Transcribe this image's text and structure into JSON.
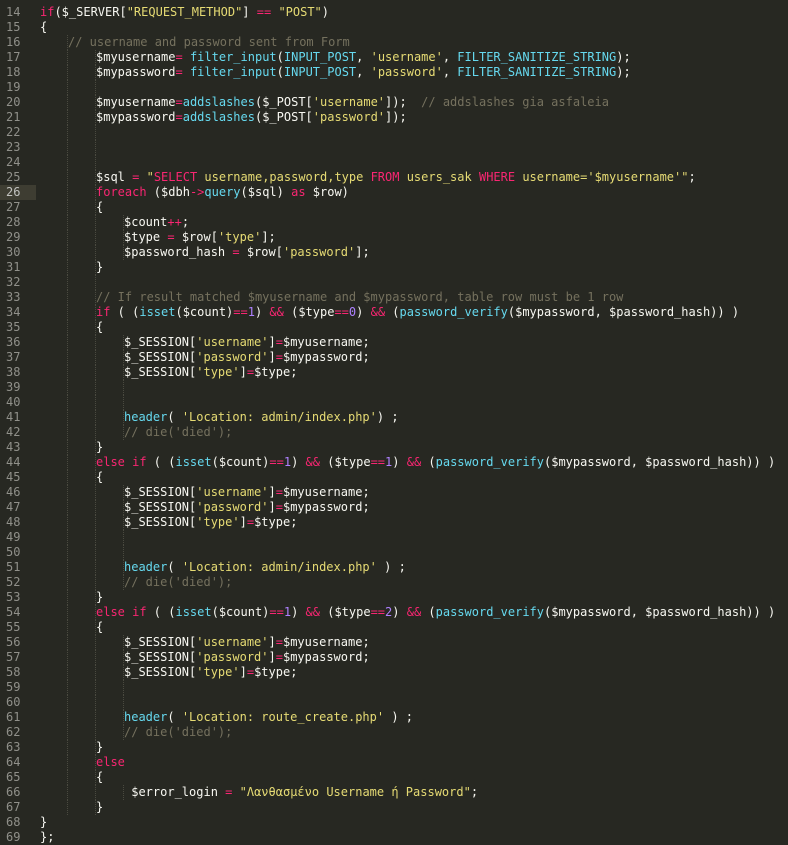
{
  "editor": {
    "colors": {
      "background": "#272822",
      "plain": "#f8f8f2",
      "keyword": "#f92672",
      "string": "#e6db74",
      "function": "#66d9ef",
      "number": "#ae81ff",
      "comment": "#75715e",
      "line_number": "#90908a"
    },
    "current_line": 26,
    "lines": [
      {
        "n": "14",
        "indent": 1,
        "tokens": [
          [
            "k",
            "if"
          ],
          [
            "p",
            "($_SERVER["
          ],
          [
            "s",
            "\"REQUEST_METHOD\""
          ],
          [
            "p",
            "] "
          ],
          [
            "k",
            "=="
          ],
          [
            "p",
            " "
          ],
          [
            "s",
            "\"POST\""
          ],
          [
            "p",
            ")"
          ]
        ]
      },
      {
        "n": "15",
        "indent": 1,
        "tokens": [
          [
            "p",
            "{"
          ]
        ]
      },
      {
        "n": "16",
        "indent": 2,
        "tokens": [
          [
            "c",
            "// username and password sent from Form"
          ]
        ]
      },
      {
        "n": "17",
        "indent": 3,
        "tokens": [
          [
            "p",
            "$myusername"
          ],
          [
            "k",
            "="
          ],
          [
            "p",
            " "
          ],
          [
            "f",
            "filter_input"
          ],
          [
            "p",
            "("
          ],
          [
            "f",
            "INPUT_POST"
          ],
          [
            "p",
            ", "
          ],
          [
            "s",
            "'username'"
          ],
          [
            "p",
            ", "
          ],
          [
            "f",
            "FILTER_SANITIZE_STRING"
          ],
          [
            "p",
            ");"
          ]
        ]
      },
      {
        "n": "18",
        "indent": 3,
        "tokens": [
          [
            "p",
            "$mypassword"
          ],
          [
            "k",
            "="
          ],
          [
            "p",
            " "
          ],
          [
            "f",
            "filter_input"
          ],
          [
            "p",
            "("
          ],
          [
            "f",
            "INPUT_POST"
          ],
          [
            "p",
            ", "
          ],
          [
            "s",
            "'password'"
          ],
          [
            "p",
            ", "
          ],
          [
            "f",
            "FILTER_SANITIZE_STRING"
          ],
          [
            "p",
            ");"
          ]
        ]
      },
      {
        "n": "19",
        "indent": 3,
        "tokens": []
      },
      {
        "n": "20",
        "indent": 3,
        "tokens": [
          [
            "p",
            "$myusername"
          ],
          [
            "k",
            "="
          ],
          [
            "f",
            "addslashes"
          ],
          [
            "p",
            "($_POST["
          ],
          [
            "s",
            "'username'"
          ],
          [
            "p",
            "]);  "
          ],
          [
            "c",
            "// addslashes gia asfaleia"
          ]
        ]
      },
      {
        "n": "21",
        "indent": 3,
        "tokens": [
          [
            "p",
            "$mypassword"
          ],
          [
            "k",
            "="
          ],
          [
            "f",
            "addslashes"
          ],
          [
            "p",
            "($_POST["
          ],
          [
            "s",
            "'password'"
          ],
          [
            "p",
            "]);"
          ]
        ]
      },
      {
        "n": "22",
        "indent": 3,
        "tokens": []
      },
      {
        "n": "23",
        "indent": 3,
        "tokens": []
      },
      {
        "n": "24",
        "indent": 3,
        "tokens": []
      },
      {
        "n": "25",
        "indent": 3,
        "tokens": [
          [
            "p",
            "$sql "
          ],
          [
            "k",
            "="
          ],
          [
            "p",
            " "
          ],
          [
            "s",
            "\""
          ],
          [
            "k",
            "SELECT"
          ],
          [
            "s",
            " username,password,type "
          ],
          [
            "k",
            "FROM"
          ],
          [
            "s",
            " users_sak "
          ],
          [
            "k",
            "WHERE"
          ],
          [
            "s",
            " username='$myusername'\""
          ],
          [
            "p",
            ";"
          ]
        ]
      },
      {
        "n": "26",
        "indent": 3,
        "tokens": [
          [
            "k",
            "foreach"
          ],
          [
            "p",
            " ($dbh"
          ],
          [
            "k",
            "->"
          ],
          [
            "f",
            "query"
          ],
          [
            "p",
            "($sql) "
          ],
          [
            "k",
            "as"
          ],
          [
            "p",
            " $row)"
          ]
        ]
      },
      {
        "n": "27",
        "indent": 3,
        "tokens": [
          [
            "p",
            "{"
          ]
        ]
      },
      {
        "n": "28",
        "indent": 4,
        "tokens": [
          [
            "p",
            "$count"
          ],
          [
            "k",
            "++"
          ],
          [
            "p",
            ";"
          ]
        ]
      },
      {
        "n": "29",
        "indent": 4,
        "tokens": [
          [
            "p",
            "$type "
          ],
          [
            "k",
            "="
          ],
          [
            "p",
            " $row["
          ],
          [
            "s",
            "'type'"
          ],
          [
            "p",
            "];"
          ]
        ]
      },
      {
        "n": "30",
        "indent": 4,
        "tokens": [
          [
            "p",
            "$password_hash "
          ],
          [
            "k",
            "="
          ],
          [
            "p",
            " $row["
          ],
          [
            "s",
            "'password'"
          ],
          [
            "p",
            "];"
          ]
        ]
      },
      {
        "n": "31",
        "indent": 3,
        "tokens": [
          [
            "p",
            "}"
          ]
        ]
      },
      {
        "n": "32",
        "indent": 3,
        "tokens": []
      },
      {
        "n": "33",
        "indent": 3,
        "tokens": [
          [
            "c",
            "// If result matched $myusername and $mypassword, table row must be 1 row"
          ]
        ]
      },
      {
        "n": "34",
        "indent": 3,
        "tokens": [
          [
            "k",
            "if"
          ],
          [
            "p",
            " ( ("
          ],
          [
            "f",
            "isset"
          ],
          [
            "p",
            "($count)"
          ],
          [
            "k",
            "=="
          ],
          [
            "n",
            "1"
          ],
          [
            "p",
            ") "
          ],
          [
            "k",
            "&&"
          ],
          [
            "p",
            " ($type"
          ],
          [
            "k",
            "=="
          ],
          [
            "n",
            "0"
          ],
          [
            "p",
            ") "
          ],
          [
            "k",
            "&&"
          ],
          [
            "p",
            " ("
          ],
          [
            "f",
            "password_verify"
          ],
          [
            "p",
            "($mypassword, $password_hash)) )"
          ]
        ]
      },
      {
        "n": "35",
        "indent": 3,
        "tokens": [
          [
            "p",
            "{"
          ]
        ]
      },
      {
        "n": "36",
        "indent": 4,
        "tokens": [
          [
            "p",
            "$_SESSION["
          ],
          [
            "s",
            "'username'"
          ],
          [
            "p",
            "]"
          ],
          [
            "k",
            "="
          ],
          [
            "p",
            "$myusername;"
          ]
        ]
      },
      {
        "n": "37",
        "indent": 4,
        "tokens": [
          [
            "p",
            "$_SESSION["
          ],
          [
            "s",
            "'password'"
          ],
          [
            "p",
            "]"
          ],
          [
            "k",
            "="
          ],
          [
            "p",
            "$mypassword;"
          ]
        ]
      },
      {
        "n": "38",
        "indent": 4,
        "tokens": [
          [
            "p",
            "$_SESSION["
          ],
          [
            "s",
            "'type'"
          ],
          [
            "p",
            "]"
          ],
          [
            "k",
            "="
          ],
          [
            "p",
            "$type;"
          ]
        ]
      },
      {
        "n": "39",
        "indent": 4,
        "tokens": []
      },
      {
        "n": "40",
        "indent": 4,
        "tokens": []
      },
      {
        "n": "41",
        "indent": 4,
        "tokens": [
          [
            "f",
            "header"
          ],
          [
            "p",
            "( "
          ],
          [
            "s",
            "'Location: admin/index.php'"
          ],
          [
            "p",
            ") ;"
          ]
        ]
      },
      {
        "n": "42",
        "indent": 4,
        "tokens": [
          [
            "c",
            "// die('died');"
          ]
        ]
      },
      {
        "n": "43",
        "indent": 3,
        "tokens": [
          [
            "p",
            "}"
          ]
        ]
      },
      {
        "n": "44",
        "indent": 3,
        "tokens": [
          [
            "k",
            "else if"
          ],
          [
            "p",
            " ( ("
          ],
          [
            "f",
            "isset"
          ],
          [
            "p",
            "($count)"
          ],
          [
            "k",
            "=="
          ],
          [
            "n",
            "1"
          ],
          [
            "p",
            ") "
          ],
          [
            "k",
            "&&"
          ],
          [
            "p",
            " ($type"
          ],
          [
            "k",
            "=="
          ],
          [
            "n",
            "1"
          ],
          [
            "p",
            ") "
          ],
          [
            "k",
            "&&"
          ],
          [
            "p",
            " ("
          ],
          [
            "f",
            "password_verify"
          ],
          [
            "p",
            "($mypassword, $password_hash)) )"
          ]
        ]
      },
      {
        "n": "45",
        "indent": 3,
        "tokens": [
          [
            "p",
            "{"
          ]
        ]
      },
      {
        "n": "46",
        "indent": 4,
        "tokens": [
          [
            "p",
            "$_SESSION["
          ],
          [
            "s",
            "'username'"
          ],
          [
            "p",
            "]"
          ],
          [
            "k",
            "="
          ],
          [
            "p",
            "$myusername;"
          ]
        ]
      },
      {
        "n": "47",
        "indent": 4,
        "tokens": [
          [
            "p",
            "$_SESSION["
          ],
          [
            "s",
            "'password'"
          ],
          [
            "p",
            "]"
          ],
          [
            "k",
            "="
          ],
          [
            "p",
            "$mypassword;"
          ]
        ]
      },
      {
        "n": "48",
        "indent": 4,
        "tokens": [
          [
            "p",
            "$_SESSION["
          ],
          [
            "s",
            "'type'"
          ],
          [
            "p",
            "]"
          ],
          [
            "k",
            "="
          ],
          [
            "p",
            "$type;"
          ]
        ]
      },
      {
        "n": "49",
        "indent": 4,
        "tokens": []
      },
      {
        "n": "50",
        "indent": 4,
        "tokens": []
      },
      {
        "n": "51",
        "indent": 4,
        "tokens": [
          [
            "f",
            "header"
          ],
          [
            "p",
            "( "
          ],
          [
            "s",
            "'Location: admin/index.php'"
          ],
          [
            "p",
            " ) ;"
          ]
        ]
      },
      {
        "n": "52",
        "indent": 4,
        "tokens": [
          [
            "c",
            "// die('died');"
          ]
        ]
      },
      {
        "n": "53",
        "indent": 3,
        "tokens": [
          [
            "p",
            "}"
          ]
        ]
      },
      {
        "n": "54",
        "indent": 3,
        "tokens": [
          [
            "k",
            "else if"
          ],
          [
            "p",
            " ( ("
          ],
          [
            "f",
            "isset"
          ],
          [
            "p",
            "($count)"
          ],
          [
            "k",
            "=="
          ],
          [
            "n",
            "1"
          ],
          [
            "p",
            ") "
          ],
          [
            "k",
            "&&"
          ],
          [
            "p",
            " ($type"
          ],
          [
            "k",
            "=="
          ],
          [
            "n",
            "2"
          ],
          [
            "p",
            ") "
          ],
          [
            "k",
            "&&"
          ],
          [
            "p",
            " ("
          ],
          [
            "f",
            "password_verify"
          ],
          [
            "p",
            "($mypassword, $password_hash)) )"
          ]
        ]
      },
      {
        "n": "55",
        "indent": 3,
        "tokens": [
          [
            "p",
            "{"
          ]
        ]
      },
      {
        "n": "56",
        "indent": 4,
        "tokens": [
          [
            "p",
            "$_SESSION["
          ],
          [
            "s",
            "'username'"
          ],
          [
            "p",
            "]"
          ],
          [
            "k",
            "="
          ],
          [
            "p",
            "$myusername;"
          ]
        ]
      },
      {
        "n": "57",
        "indent": 4,
        "tokens": [
          [
            "p",
            "$_SESSION["
          ],
          [
            "s",
            "'password'"
          ],
          [
            "p",
            "]"
          ],
          [
            "k",
            "="
          ],
          [
            "p",
            "$mypassword;"
          ]
        ]
      },
      {
        "n": "58",
        "indent": 4,
        "tokens": [
          [
            "p",
            "$_SESSION["
          ],
          [
            "s",
            "'type'"
          ],
          [
            "p",
            "]"
          ],
          [
            "k",
            "="
          ],
          [
            "p",
            "$type;"
          ]
        ]
      },
      {
        "n": "59",
        "indent": 4,
        "tokens": []
      },
      {
        "n": "60",
        "indent": 4,
        "tokens": []
      },
      {
        "n": "61",
        "indent": 4,
        "tokens": [
          [
            "f",
            "header"
          ],
          [
            "p",
            "( "
          ],
          [
            "s",
            "'Location: route_create.php'"
          ],
          [
            "p",
            " ) ;"
          ]
        ]
      },
      {
        "n": "62",
        "indent": 4,
        "tokens": [
          [
            "c",
            "// die('died');"
          ]
        ]
      },
      {
        "n": "63",
        "indent": 3,
        "tokens": [
          [
            "p",
            "}"
          ]
        ]
      },
      {
        "n": "64",
        "indent": 3,
        "tokens": [
          [
            "k",
            "else"
          ]
        ]
      },
      {
        "n": "65",
        "indent": 3,
        "tokens": [
          [
            "p",
            "{"
          ]
        ]
      },
      {
        "n": "66",
        "indent": 4,
        "tokens": [
          [
            "p",
            " $error_login "
          ],
          [
            "k",
            "="
          ],
          [
            "p",
            " "
          ],
          [
            "s",
            "\"Λανθασμένο Username ή Password\""
          ],
          [
            "p",
            ";"
          ]
        ]
      },
      {
        "n": "67",
        "indent": 3,
        "tokens": [
          [
            "p",
            "}"
          ]
        ]
      },
      {
        "n": "68",
        "indent": 1,
        "tokens": [
          [
            "p",
            "}"
          ]
        ]
      },
      {
        "n": "69",
        "indent": 0,
        "tokens": [
          [
            "p",
            "};"
          ]
        ]
      }
    ]
  }
}
